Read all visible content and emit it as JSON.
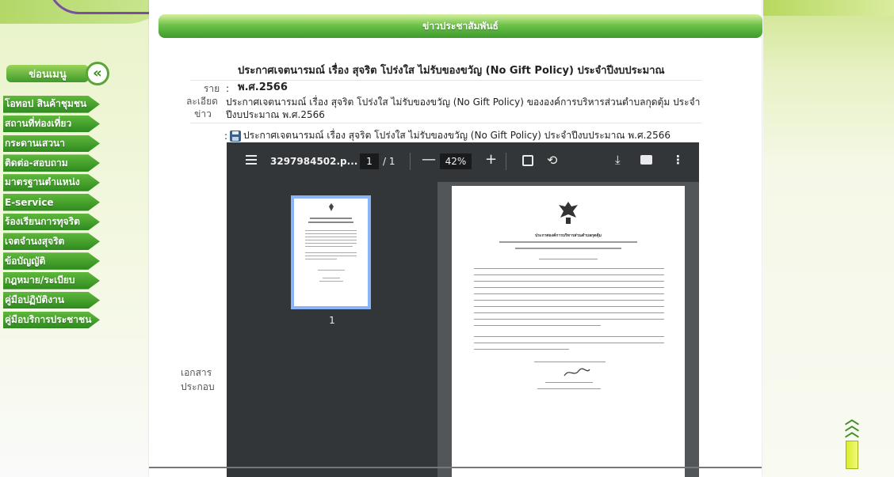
{
  "header": {
    "banner": "ข่าวประชาสัมพันธ์"
  },
  "sidebar": {
    "title": "ข่อนเมนู",
    "toggle_icon": "double-chevron-left-icon",
    "items": [
      {
        "label": "โอทอป สินค้าชุมชน"
      },
      {
        "label": "สถานที่ท่องเที่ยว"
      },
      {
        "label": "กระดานเสวนา"
      },
      {
        "label": "ติดต่อ-สอบถาม"
      },
      {
        "label": "มาตรฐานตำแหน่ง"
      },
      {
        "label": "E-service"
      },
      {
        "label": "ร้องเรียนการทุจริต"
      },
      {
        "label": "เจตจำนงสุจริต"
      },
      {
        "label": "ข้อบัญญัติ"
      },
      {
        "label": "กฎหมาย/ระเบียบ"
      },
      {
        "label": "คู่มือปฏิบัติงาน"
      },
      {
        "label": "คู่มือบริการประชาชน"
      }
    ]
  },
  "news": {
    "title": "ประกาศเจตนารมณ์ เรื่อง สุจริต โปร่งใส ไม่รับของขวัญ (No Gift Policy) ประจำปีงบประมาณ พ.ศ.2566",
    "detail_label_1": "ราย",
    "detail_label_2": "ละเอียด",
    "detail_label_3": "ข่าว",
    "detail_colon": ":",
    "detail_line_1": "ประกาศเจตนารมณ์ เรื่อง สุจริต โปร่งใส ไม่รับของขวัญ (No Gift Policy) ขององค์การบริหารส่วนตำบลกุดตุ้ม ประจำ",
    "detail_line_2": "ปีงบประมาณ พ.ศ.2566",
    "attachment_prefix": ":",
    "attachment_icon": "floppy-disk-icon",
    "attachment_title": "ประกาศเจตนารมณ์ เรื่อง สุจริต โปร่งใส ไม่รับของขวัญ (No Gift Policy) ประจำปีงบประมาณ พ.ศ.2566",
    "doc_label_1": "เอกสาร",
    "doc_label_2": "ประกอบ"
  },
  "pdf_viewer": {
    "menu_icon": "hamburger-menu-icon",
    "filename": "3297984502.p...",
    "current_page": "1",
    "page_total": "/ 1",
    "zoom_out": "—",
    "zoom": "42%",
    "zoom_in": "+",
    "fit_icon": "fit-page-icon",
    "rotate_icon": "rotate-icon",
    "download_icon": "download-icon",
    "print_icon": "print-icon",
    "more_icon": "more-vertical-icon",
    "thumb_page_number": "1",
    "page_heading": "ประกาศองค์การบริหารส่วนตำบลกุดตุ้ม"
  },
  "scroll_top_icon": "scroll-to-top-icon",
  "colors": {
    "menu_green": "#2e8a1e",
    "banner_green": "#3c9a2c",
    "viewer_toolbar": "#323639",
    "viewer_bg": "#525659",
    "thumb_border": "#8ab4f8"
  }
}
